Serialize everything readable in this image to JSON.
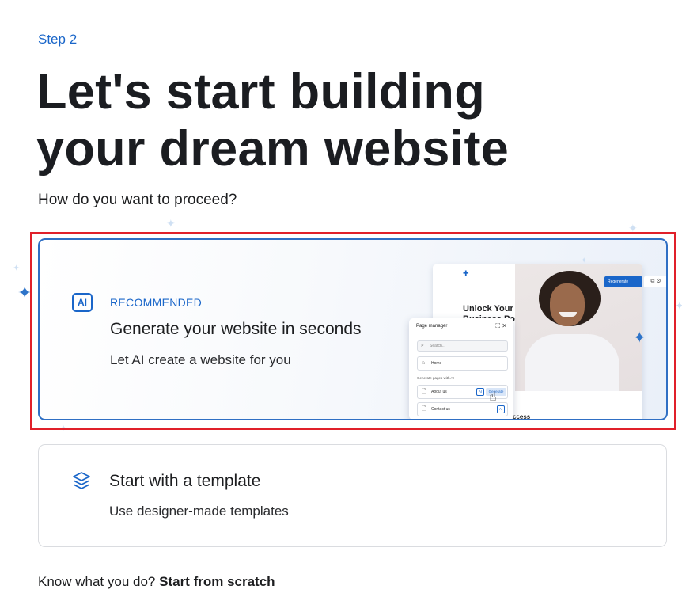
{
  "step_label": "Step 2",
  "headline": "Let's start building your dream website",
  "question": "How do you want to proceed?",
  "ai_option": {
    "icon_text": "AI",
    "badge": "RECOMMENDED",
    "title": "Generate your website in seconds",
    "subtitle": "Let AI create a website for you",
    "preview": {
      "heading": "Unlock Your Business Potential",
      "regenerate_label": "Regenerate",
      "page_manager": {
        "title": "Page manager",
        "search_placeholder": "Search...",
        "home": "Home",
        "generate_label": "Generate pages with AI",
        "pages": [
          "About us",
          "Contact us"
        ],
        "ai_chip": "AI",
        "generate_chip": "Generate"
      },
      "bottom_text": "ccess"
    }
  },
  "template_option": {
    "icon": "layers-icon",
    "title": "Start with a template",
    "subtitle": "Use designer-made templates"
  },
  "footer": {
    "prompt": "Know what you do? ",
    "link": "Start from scratch"
  },
  "colors": {
    "accent": "#1a66c9",
    "highlight_border": "#e0202a"
  }
}
